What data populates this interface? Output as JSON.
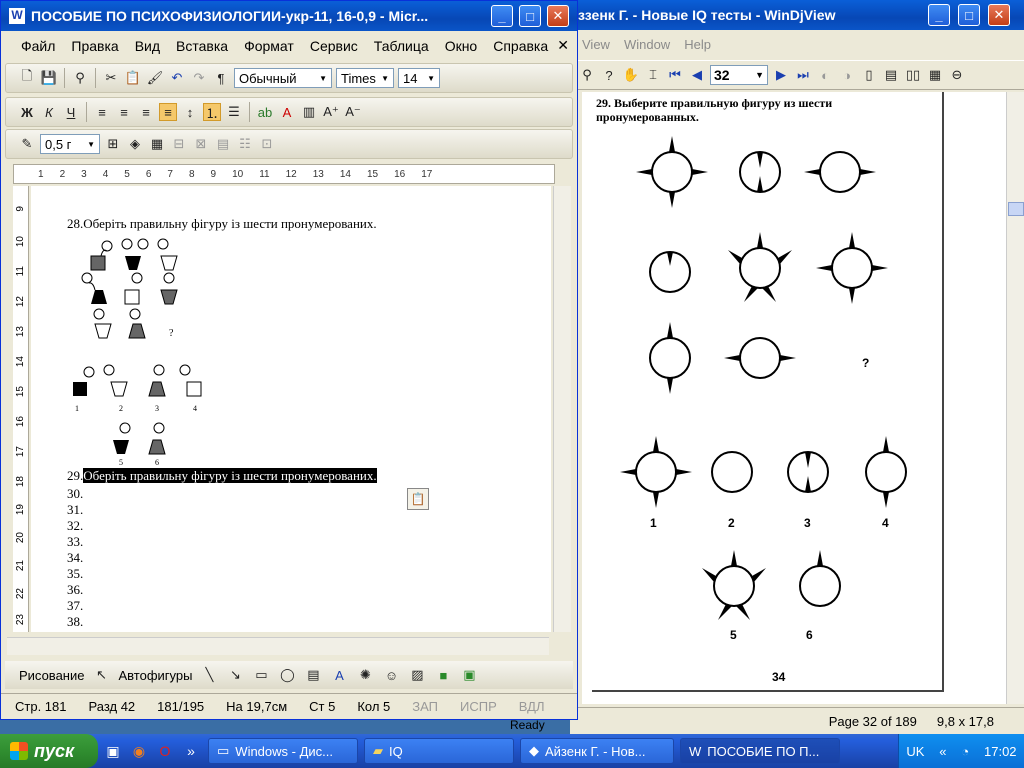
{
  "djvu": {
    "title": "ззенк Г. - Новые IQ тесты - WinDjView",
    "menu": [
      "View",
      "Window",
      "Help"
    ],
    "page_number": "32",
    "heading": "29. Выберите правильную фигуру из шести пронумерованных.",
    "question_mark": "?",
    "answer_labels": [
      "1",
      "2",
      "3",
      "4",
      "5",
      "6"
    ],
    "printed_page": "34",
    "status_page": "Page 32 of 189",
    "status_size": "9,8 x 17,8",
    "status_ready": "Ready"
  },
  "word": {
    "title": "ПОСОБИЕ ПО ПСИХОФИЗИОЛОГИИ-укр-11, 16-0,9 - Micr...",
    "menu": [
      "Файл",
      "Правка",
      "Вид",
      "Вставка",
      "Формат",
      "Сервис",
      "Таблица",
      "Окно",
      "Справка"
    ],
    "style_combo": "Обычный",
    "font_combo": "Times",
    "size_combo": "14",
    "indent_combo": "0,5 г",
    "ruler_marks": [
      "1",
      "2",
      "3",
      "4",
      "5",
      "6",
      "7",
      "8",
      "9",
      "10",
      "11",
      "12",
      "13",
      "14",
      "15",
      "16",
      "17"
    ],
    "vruler_marks": [
      "9",
      "10",
      "11",
      "12",
      "13",
      "14",
      "15",
      "16",
      "17",
      "18",
      "19",
      "20",
      "21",
      "22",
      "23"
    ],
    "doc": {
      "q28_num": "28.",
      "q28_text": "Оберіть правильну фігуру із шести пронумерованих.",
      "q28_qmark": "?",
      "q28_labels": [
        "1",
        "2",
        "3",
        "4",
        "5",
        "6"
      ],
      "q29_num": "29.",
      "q29_text": "Оберіть правильну фігуру із шести пронумерованих.",
      "numbers": [
        "30.",
        "31.",
        "32.",
        "33.",
        "34.",
        "35.",
        "36.",
        "37.",
        "38."
      ]
    },
    "draw_label": "Рисование",
    "autoshapes_label": "Автофигуры",
    "status": {
      "page": "Стр. 181",
      "section": "Разд 42",
      "pages": "181/195",
      "at": "На 19,7см",
      "line": "Ст 5",
      "col": "Кол 5",
      "rec": "ЗАП",
      "trk": "ИСПР",
      "ext": "ВДЛ"
    }
  },
  "taskbar": {
    "start_label": "пуск",
    "tasks": [
      "Windows - Дис...",
      "IQ",
      "Айзенк Г. - Нов...",
      "ПОСОБИЕ ПО П..."
    ],
    "lang": "UK",
    "clock": "17:02"
  }
}
